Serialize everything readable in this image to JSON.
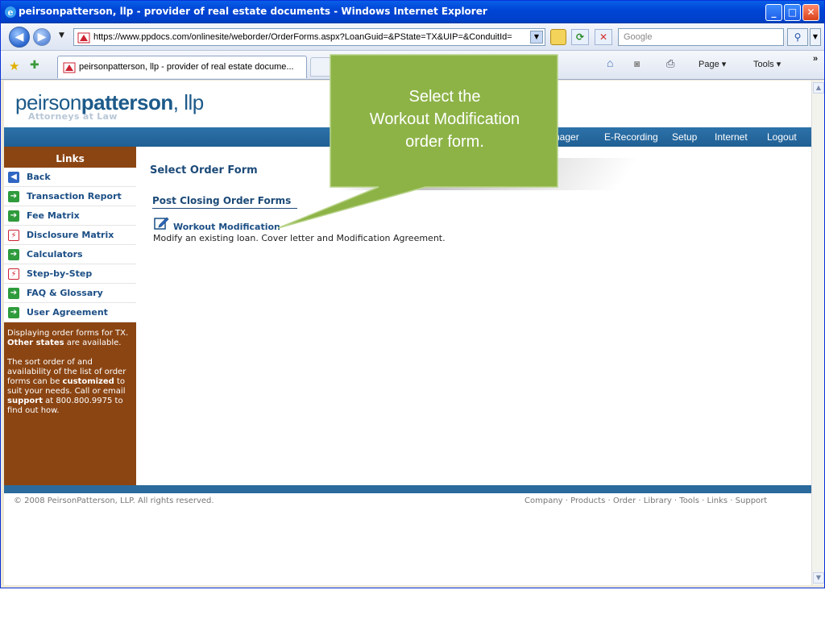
{
  "window": {
    "title": "peirsonpatterson, llp - provider of real estate documents - Windows Internet Explorer"
  },
  "browser": {
    "address": "https://www.ppdocs.com/onlinesite/weborder/OrderForms.aspx?LoanGuid=&PState=TX&UIP=&ConduitId=",
    "search_placeholder": "Google",
    "tab_label": "peirsonpatterson, llp - provider of real estate docume...",
    "commands": {
      "page": "Page ▾",
      "tools": "Tools ▾",
      "more": "»"
    },
    "icons": [
      "ie-icon",
      "back-arrow-icon",
      "forward-arrow-icon",
      "lock-icon",
      "refresh-icon",
      "stop-icon",
      "search-icon",
      "favorites-star-icon",
      "add-favorites-icon",
      "home-icon",
      "feeds-icon",
      "print-icon"
    ]
  },
  "site": {
    "logo_light": "peirson",
    "logo_bold": "patterson",
    "logo_suffix": ", llp",
    "tagline": "Attorneys at Law"
  },
  "menu": [
    "nager",
    "E-Recording",
    "Setup",
    "Internet",
    "Logout"
  ],
  "links": {
    "heading": "Links",
    "items": [
      {
        "label": "Back",
        "icon": "back-arrow-icon"
      },
      {
        "label": "Transaction Report",
        "icon": "arrow-right-icon"
      },
      {
        "label": "Fee Matrix",
        "icon": "arrow-right-icon"
      },
      {
        "label": "Disclosure Matrix",
        "icon": "pdf-icon"
      },
      {
        "label": "Calculators",
        "icon": "arrow-right-icon"
      },
      {
        "label": "Step-by-Step",
        "icon": "pdf-icon"
      },
      {
        "label": "FAQ & Glossary",
        "icon": "arrow-right-icon"
      },
      {
        "label": "User Agreement",
        "icon": "arrow-right-icon"
      }
    ],
    "info1_pre": "Displaying order forms for TX.",
    "info1_bold": "Other states",
    "info1_post": "are available.",
    "info2_pre": "The sort order of and availability of the list of order forms can be",
    "info2_bold": "customized",
    "info2_mid": "to suit your needs. Call or email",
    "info2_bold2": "support",
    "info2_post": "at 800.800.9975 to find out how."
  },
  "main": {
    "heading": "Select Order Form",
    "section": "Post Closing Order Forms",
    "form_link": "Workout Modification",
    "form_desc": "Modify an existing loan. Cover letter and Modification Agreement."
  },
  "footer": {
    "copyright": "© 2008 PeirsonPatterson, LLP. All rights reserved.",
    "links": "Company · Products · Order · Library · Tools · Links · Support"
  },
  "callout": {
    "line1": "Select the",
    "line2": "Workout Modification",
    "line3": "order form.",
    "fill_color": "#8db347"
  }
}
